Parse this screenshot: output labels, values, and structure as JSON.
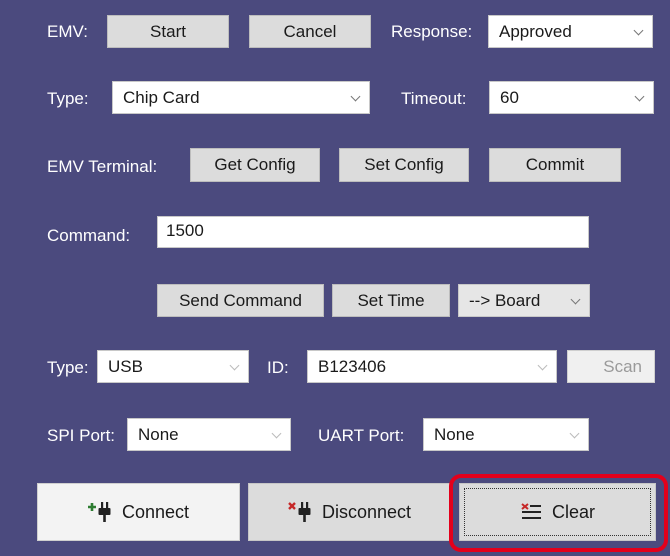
{
  "emv": {
    "label": "EMV:",
    "start": "Start",
    "cancel": "Cancel",
    "response_label": "Response:",
    "response_value": "Approved"
  },
  "card": {
    "type_label": "Type:",
    "type_value": "Chip Card",
    "timeout_label": "Timeout:",
    "timeout_value": "60"
  },
  "terminal": {
    "label": "EMV Terminal:",
    "get_config": "Get Config",
    "set_config": "Set Config",
    "commit": "Commit"
  },
  "command": {
    "label": "Command:",
    "value": "1500",
    "send": "Send Command",
    "set_time": "Set Time",
    "target": "--> Board"
  },
  "connection": {
    "type_label": "Type:",
    "type_value": "USB",
    "id_label": "ID:",
    "id_value": "B123406",
    "scan": "Scan"
  },
  "ports": {
    "spi_label": "SPI Port:",
    "spi_value": "None",
    "uart_label": "UART Port:",
    "uart_value": "None"
  },
  "actions": {
    "connect": "Connect",
    "disconnect": "Disconnect",
    "clear": "Clear"
  },
  "colors": {
    "panel": "#4b4a7e",
    "highlight": "#e3001b",
    "connect_icon": "#2e7d32",
    "disconnect_icon": "#c62828"
  }
}
